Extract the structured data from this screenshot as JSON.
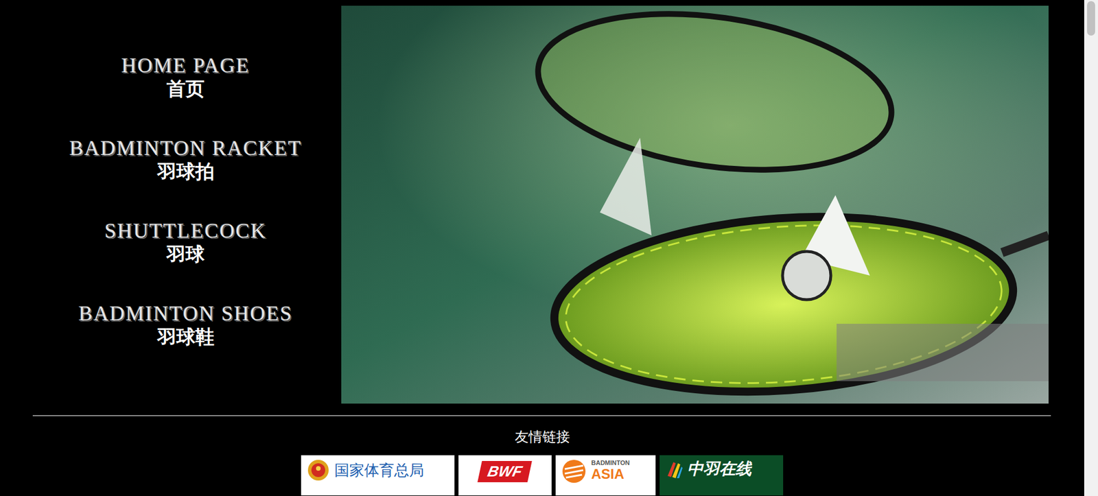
{
  "nav": [
    {
      "en": "HOME PAGE",
      "zh": "首页"
    },
    {
      "en": "BADMINTON RACKET",
      "zh": "羽球拍"
    },
    {
      "en": "SHUTTLECOCK",
      "zh": "羽球"
    },
    {
      "en": "BADMINTON SHOES",
      "zh": "羽球鞋"
    }
  ],
  "friend_links": {
    "title": "友情链接",
    "items": [
      {
        "kind": "gov",
        "lines": [
          "国家体育总局"
        ]
      },
      {
        "kind": "bwf",
        "lines": [
          "BWF"
        ]
      },
      {
        "kind": "asia",
        "lines": [
          "BADMINTON",
          "ASIA"
        ]
      },
      {
        "kind": "zhongyu",
        "lines": [
          "中羽在线"
        ]
      }
    ]
  },
  "scrollbar": {
    "level": 0.07
  }
}
